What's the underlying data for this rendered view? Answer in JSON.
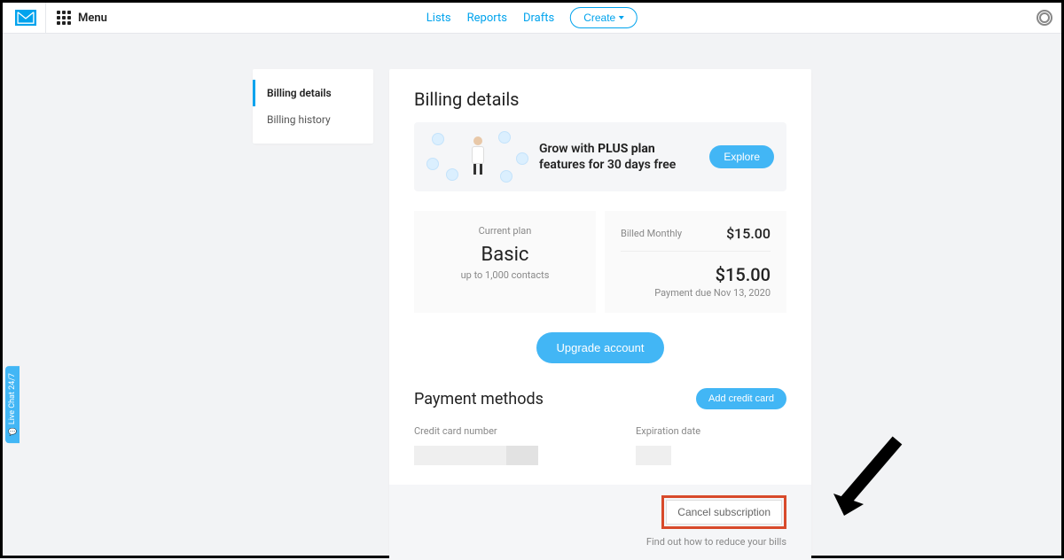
{
  "header": {
    "menu_label": "Menu",
    "nav": {
      "lists": "Lists",
      "reports": "Reports",
      "drafts": "Drafts"
    },
    "create_label": "Create"
  },
  "sidebar": {
    "items": [
      {
        "label": "Billing details"
      },
      {
        "label": "Billing history"
      }
    ]
  },
  "page": {
    "title": "Billing details"
  },
  "promo": {
    "text_prefix": "Grow with ",
    "text_bold": "PLUS plan",
    "text_suffix": " features for 30 days free",
    "explore_label": "Explore"
  },
  "plan": {
    "current_label": "Current plan",
    "name": "Basic",
    "sub": "up to 1,000 contacts",
    "billed_label": "Billed Monthly",
    "billed_amount": "$15.00",
    "total": "$15.00",
    "due": "Payment due Nov 13, 2020"
  },
  "upgrade_label": "Upgrade account",
  "payment": {
    "title": "Payment methods",
    "add_label": "Add credit card",
    "cc_label": "Credit card number",
    "exp_label": "Expiration date"
  },
  "cancel": {
    "label": "Cancel subscription",
    "reduce": "Find out how to reduce your bills"
  },
  "livechat_label": "Live Chat 24/7"
}
